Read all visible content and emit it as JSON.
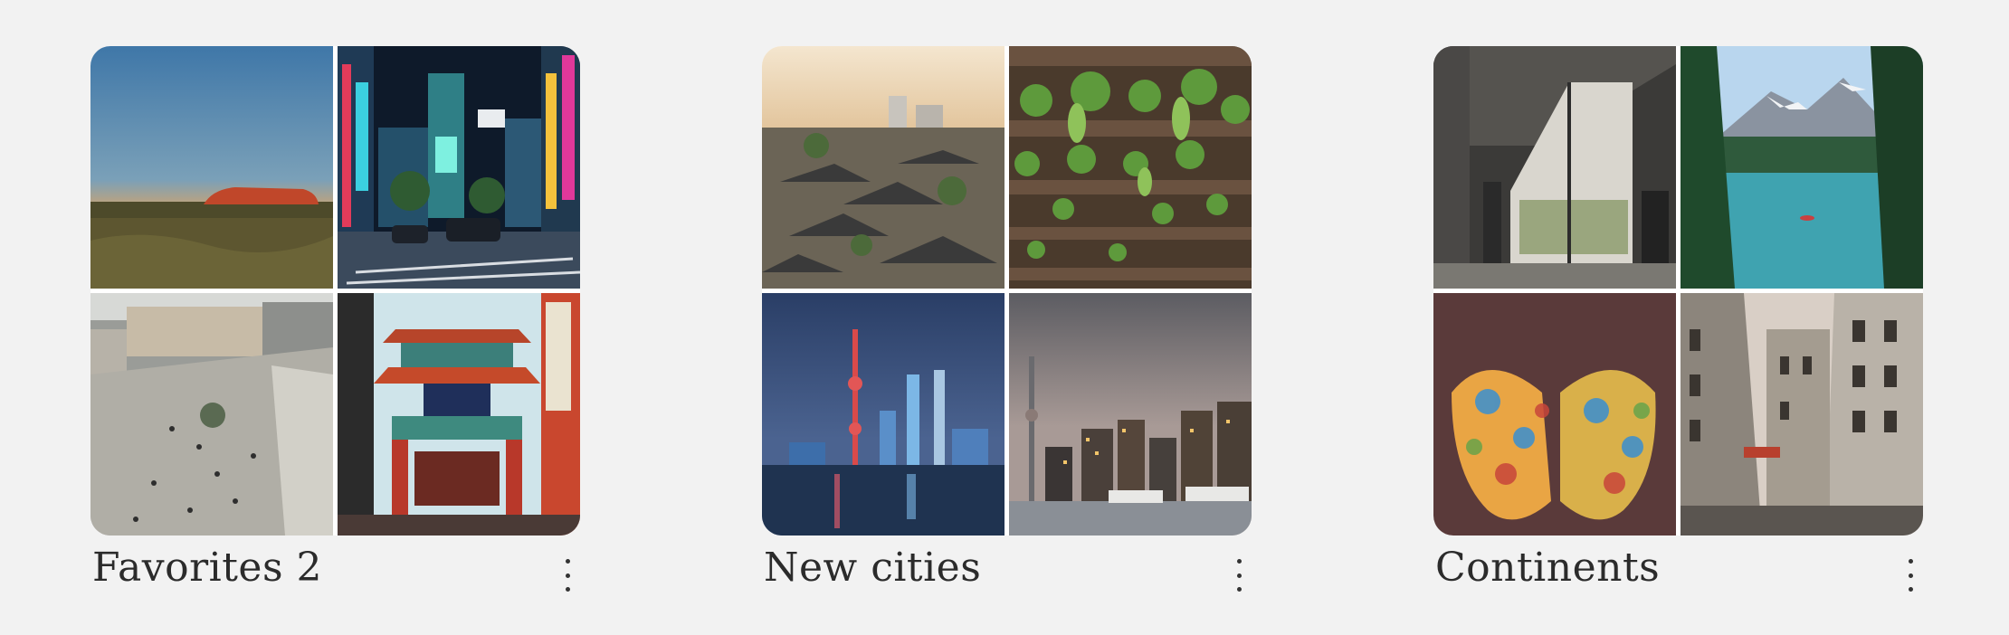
{
  "collections": [
    {
      "title": "Favorites 2",
      "more_icon": "more-vertical-icon",
      "photos": [
        "desert-rock-dusk",
        "neon-city-street",
        "european-plaza-aerial",
        "chinatown-gate"
      ]
    },
    {
      "title": "New cities",
      "more_icon": "more-vertical-icon",
      "photos": [
        "old-town-rooftops-sunset",
        "grape-vine-pergola",
        "shanghai-skyline-night",
        "toronto-skyline-dusk"
      ]
    },
    {
      "title": "Continents",
      "more_icon": "more-vertical-icon",
      "photos": [
        "modern-interior-window",
        "mountain-lake-canoe",
        "hands-colored-powder",
        "paris-street-dusk"
      ]
    }
  ]
}
